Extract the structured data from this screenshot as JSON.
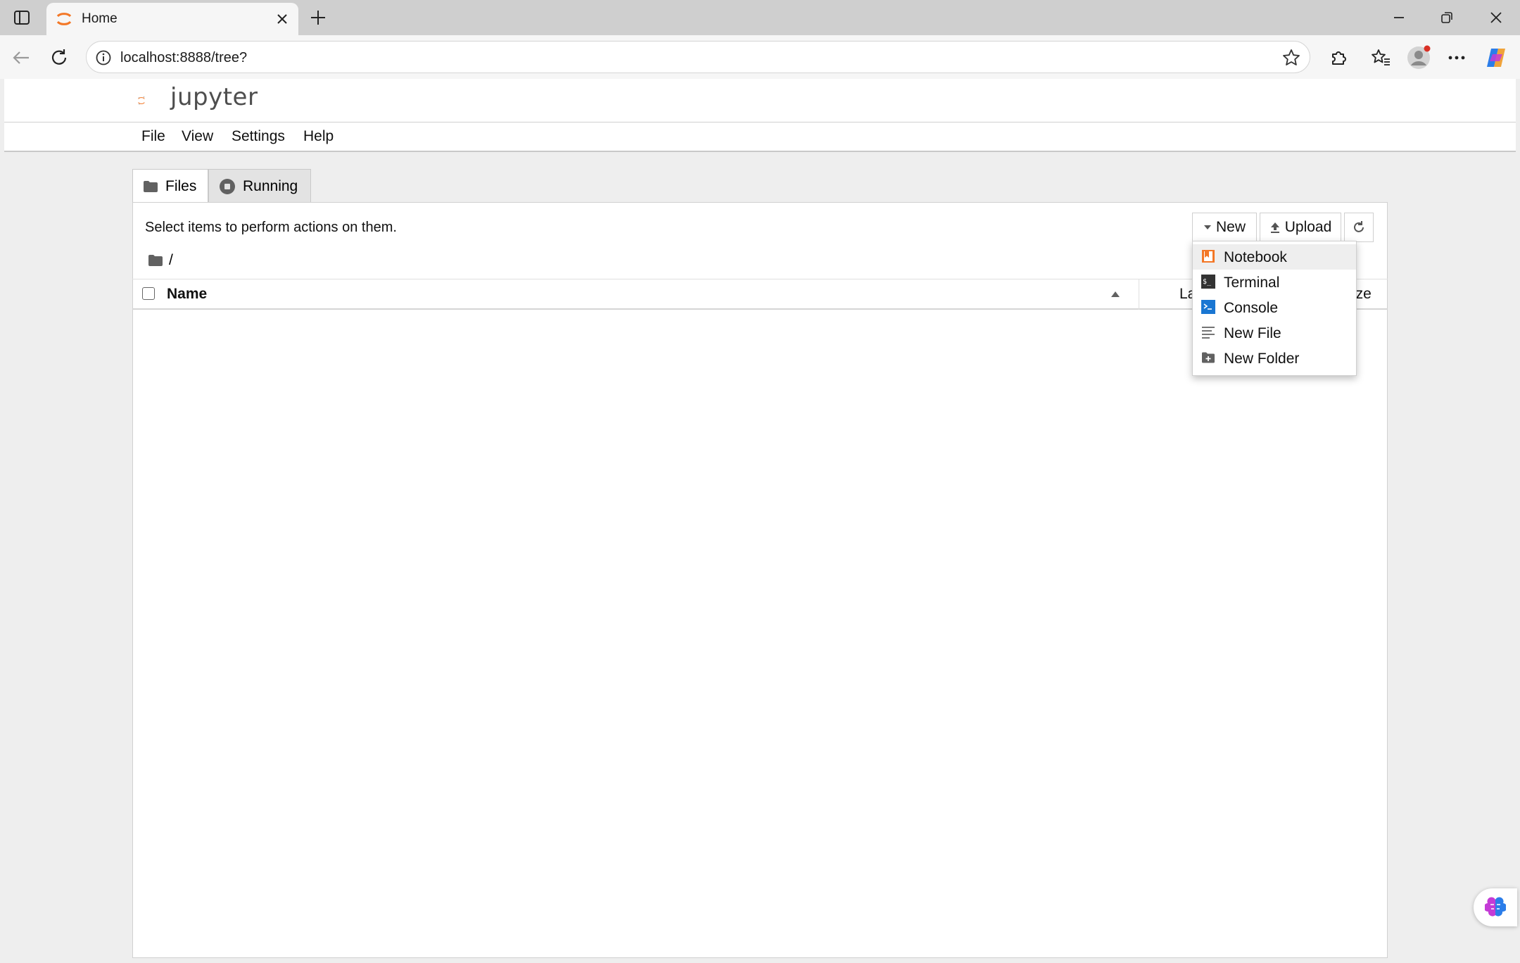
{
  "browser": {
    "tab_title": "Home",
    "address": "localhost:8888/tree?"
  },
  "jupyter": {
    "logo_text": "jupyter",
    "menu": [
      "File",
      "View",
      "Settings",
      "Help"
    ],
    "tabs": [
      {
        "label": "Files",
        "icon": "folder-icon",
        "active": true
      },
      {
        "label": "Running",
        "icon": "stop-circle-icon",
        "active": false
      }
    ],
    "hint": "Select items to perform actions on them.",
    "breadcrumb": "/",
    "buttons": {
      "new_label": "New",
      "upload_label": "Upload"
    },
    "columns": {
      "name": "Name",
      "last_modified": "La",
      "size": "ize"
    },
    "new_menu": [
      {
        "label": "Notebook",
        "icon": "notebook-icon"
      },
      {
        "label": "Terminal",
        "icon": "terminal-icon"
      },
      {
        "label": "Console",
        "icon": "console-icon"
      },
      {
        "label": "New File",
        "icon": "text-file-icon"
      },
      {
        "label": "New Folder",
        "icon": "new-folder-icon"
      }
    ]
  },
  "colors": {
    "jupyter_orange": "#F37726",
    "console_blue": "#1976D2",
    "page_bg": "#EEEEEE"
  }
}
